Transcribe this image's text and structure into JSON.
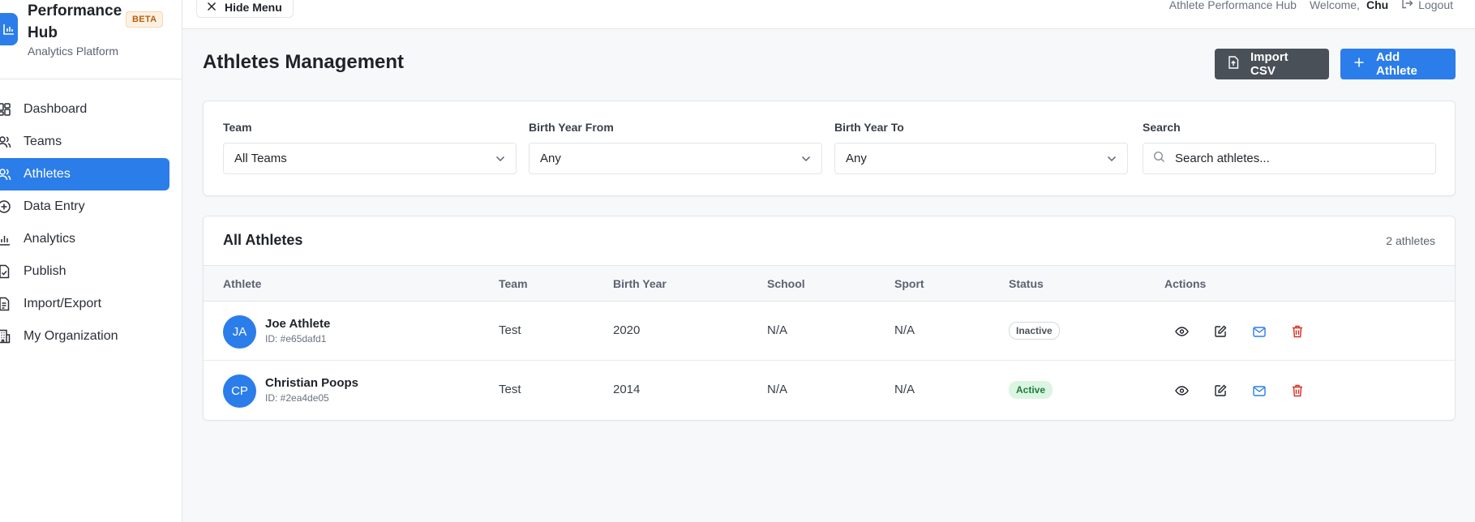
{
  "brand": {
    "title": "Performance Hub",
    "badge": "BETA",
    "subtitle": "Analytics Platform"
  },
  "sidebar": {
    "items": [
      {
        "label": "Dashboard",
        "icon": "layout-dashboard-icon"
      },
      {
        "label": "Teams",
        "icon": "users-icon"
      },
      {
        "label": "Athletes",
        "icon": "user-icon",
        "active": true
      },
      {
        "label": "Data Entry",
        "icon": "plus-circle-icon"
      },
      {
        "label": "Analytics",
        "icon": "bar-chart-icon"
      },
      {
        "label": "Publish",
        "icon": "file-check-icon"
      },
      {
        "label": "Import/Export",
        "icon": "file-text-icon"
      },
      {
        "label": "My Organization",
        "icon": "building-icon"
      }
    ]
  },
  "topbar": {
    "hide_menu": "Hide Menu",
    "app_name": "Athlete Performance Hub",
    "welcome": "Welcome,",
    "user": "Chu",
    "logout": "Logout"
  },
  "main": {
    "title": "Athletes Management",
    "import_label": "Import CSV",
    "add_label": "Add Athlete"
  },
  "filters": {
    "team_label": "Team",
    "team_value": "All Teams",
    "from_label": "Birth Year From",
    "from_value": "Any",
    "to_label": "Birth Year To",
    "to_value": "Any",
    "search_label": "Search",
    "search_placeholder": "Search athletes..."
  },
  "table": {
    "title": "All Athletes",
    "count": "2 athletes",
    "columns": [
      "Athlete",
      "Team",
      "Birth Year",
      "School",
      "Sport",
      "Status",
      "Actions"
    ],
    "rows": [
      {
        "initials": "JA",
        "name": "Joe Athlete",
        "id": "ID: #e65dafd1",
        "team": "Test",
        "birth_year": "2020",
        "school": "N/A",
        "sport": "N/A",
        "status": "Inactive"
      },
      {
        "initials": "CP",
        "name": "Christian Poops",
        "id": "ID: #2ea4de05",
        "team": "Test",
        "birth_year": "2014",
        "school": "N/A",
        "sport": "N/A",
        "status": "Active"
      }
    ]
  },
  "colors": {
    "accent": "#2b7de9",
    "dark_button": "#4a5058",
    "active_badge": "#1a7f37",
    "delete": "#d92d20"
  }
}
